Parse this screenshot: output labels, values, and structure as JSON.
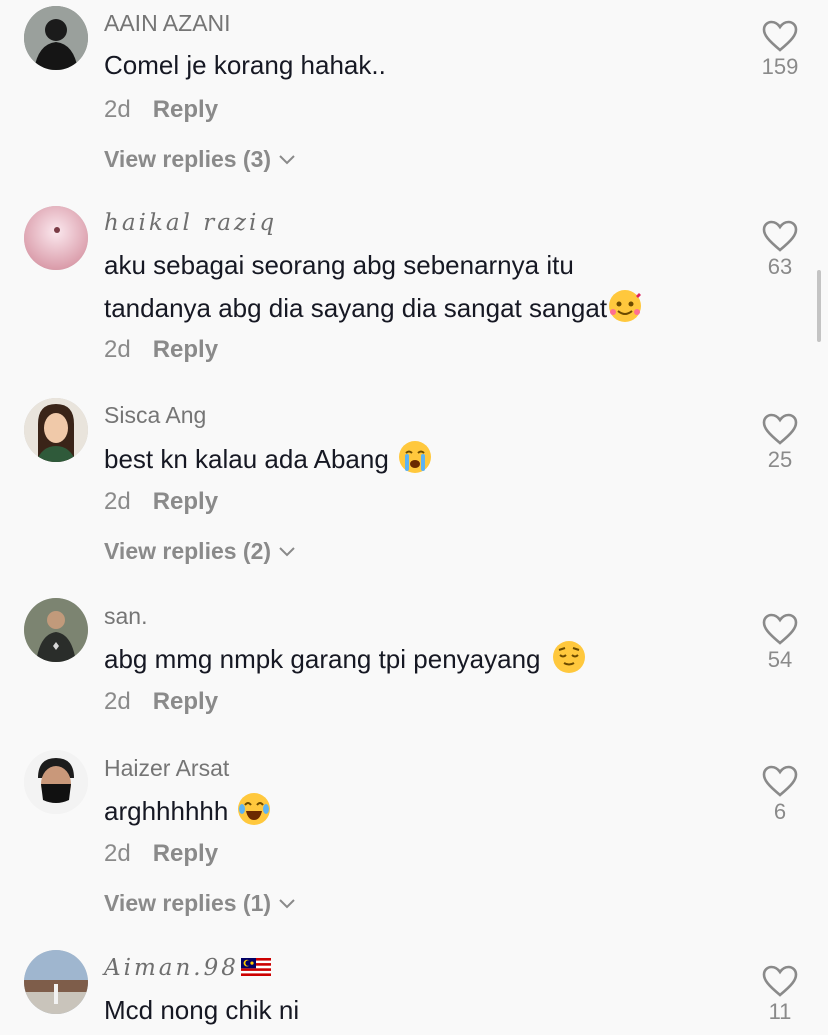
{
  "comments": [
    {
      "username": "AAIN AZANI",
      "lines": [
        "Comel je korang hahak.."
      ],
      "age": "2d",
      "reply_label": "Reply",
      "view_replies": "View replies (3)",
      "likes": "159"
    },
    {
      "username": "haikal raziq",
      "lines": [
        "aku sebagai seorang abg sebenarnya itu",
        "tandanya abg dia sayang dia sangat sangat"
      ],
      "emoji": "smiling-face-with-hearts",
      "age": "2d",
      "reply_label": "Reply",
      "likes": "63"
    },
    {
      "username": "Sisca Ang",
      "lines": [
        "best kn kalau ada Abang"
      ],
      "emoji": "loudly-crying-face",
      "age": "2d",
      "reply_label": "Reply",
      "view_replies": "View replies (2)",
      "likes": "25"
    },
    {
      "username": "san.",
      "lines": [
        "abg mmg nmpk garang tpi penyayang"
      ],
      "emoji": "relieved-face",
      "age": "2d",
      "reply_label": "Reply",
      "likes": "54"
    },
    {
      "username": "Haizer Arsat",
      "lines": [
        "arghhhhhh"
      ],
      "emoji": "face-with-tears-of-joy",
      "age": "2d",
      "reply_label": "Reply",
      "view_replies": "View replies (1)",
      "likes": "6"
    },
    {
      "username": "Aiman.98",
      "flag": "malaysia-flag",
      "lines": [
        "Mcd nong chik ni"
      ],
      "likes": "11"
    }
  ],
  "colors": {
    "background": "#f9f9f9",
    "text": "#161823",
    "secondary": "#8a8a8a",
    "emoji": "#ffc83d"
  }
}
